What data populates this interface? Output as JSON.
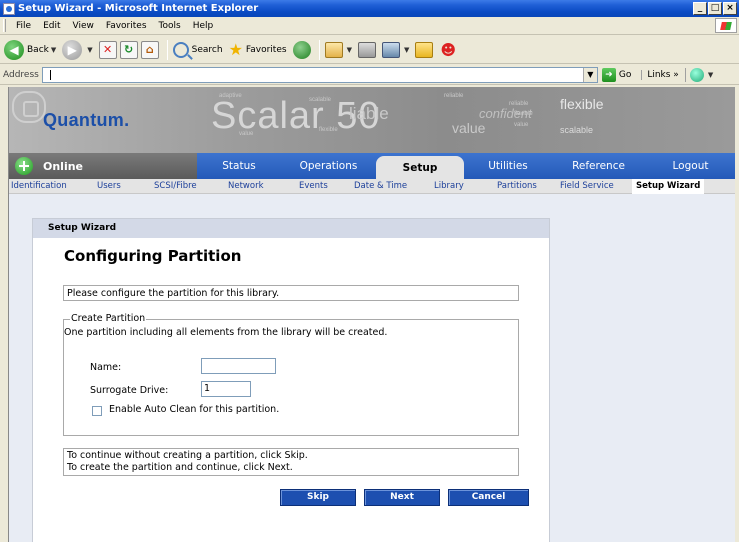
{
  "window": {
    "title": "Setup Wizard - Microsoft Internet Explorer",
    "buttons": [
      "_",
      "□",
      "×"
    ]
  },
  "menu": [
    "File",
    "Edit",
    "View",
    "Favorites",
    "Tools",
    "Help"
  ],
  "toolbar": {
    "back": "Back",
    "search": "Search",
    "favorites": "Favorites"
  },
  "addressbar": {
    "label": "Address",
    "value": "",
    "go": "Go",
    "links": "Links »"
  },
  "banner": {
    "logo": "Quantum.",
    "product": "Scalar 50",
    "words": {
      "liable": "liable",
      "value": "value",
      "confident": "confident",
      "flexible": "flexible",
      "scalable": "scalable",
      "tiny": [
        "adaptive",
        "scalable",
        "reliable",
        "flexible",
        "value",
        "flexible",
        "reliable",
        "value"
      ]
    }
  },
  "status": {
    "label": "Online"
  },
  "nav": {
    "tabs": [
      "Status",
      "Operations",
      "Setup",
      "Utilities",
      "Reference",
      "Logout"
    ],
    "active": "Setup"
  },
  "subnav": {
    "tabs": [
      "Identification",
      "Users",
      "SCSI/Fibre",
      "Network",
      "Events",
      "Date & Time",
      "Library",
      "Partitions",
      "Field Service",
      "Setup Wizard"
    ],
    "active": "Setup Wizard"
  },
  "wizard": {
    "header": "Setup Wizard",
    "title": "Configuring Partition",
    "prompt": "Please configure the partition for this library.",
    "create_partition": {
      "legend": "Create Partition",
      "description": "One partition including all elements from the library will be created.",
      "name_label": "Name:",
      "name_value": "",
      "surrogate_label": "Surrogate Drive:",
      "surrogate_value": "1",
      "auto_clean_label": "Enable Auto Clean for this partition.",
      "auto_clean_checked": false
    },
    "info_line1": "To continue without creating a partition, click Skip.",
    "info_line2": "To create the partition and continue, click Next.",
    "buttons": {
      "skip": "Skip",
      "next": "Next",
      "cancel": "Cancel"
    }
  }
}
